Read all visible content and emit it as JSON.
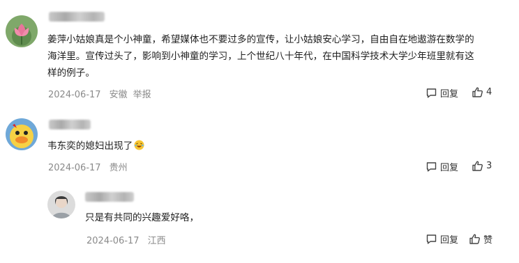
{
  "comments": [
    {
      "lines": [
        "姜萍小姑娘真是个小神童，希望媒体也不要过多的宣传，让小姑娘安心学习，自由自在地遨游在数学的",
        "海洋里。宣传过头了，影响到小神童的学习，上个世纪八十年代，在中国科学技术大学少年班里就有这",
        "样的例子。"
      ],
      "date": "2024-06-17",
      "location": "安徽",
      "report": "举报",
      "reply_label": "回复",
      "like_count": "4",
      "avatar_icon": "lotus-flower-icon"
    },
    {
      "lines": [
        "韦东奕的媳妇出现了"
      ],
      "emoji": "laughing-emoji-icon",
      "date": "2024-06-17",
      "location": "贵州",
      "reply_label": "回复",
      "like_count": "3",
      "avatar_icon": "cartoon-duck-icon"
    },
    {
      "lines": [
        "只是有共同的兴趣爱好咯，"
      ],
      "date": "2024-06-17",
      "location": "江西",
      "reply_label": "回复",
      "like_label": "赞",
      "avatar_icon": "person-photo-icon"
    }
  ],
  "colors": {
    "background": "#ffffff",
    "text": "#1f1f1f",
    "meta": "#8a8a8a"
  }
}
